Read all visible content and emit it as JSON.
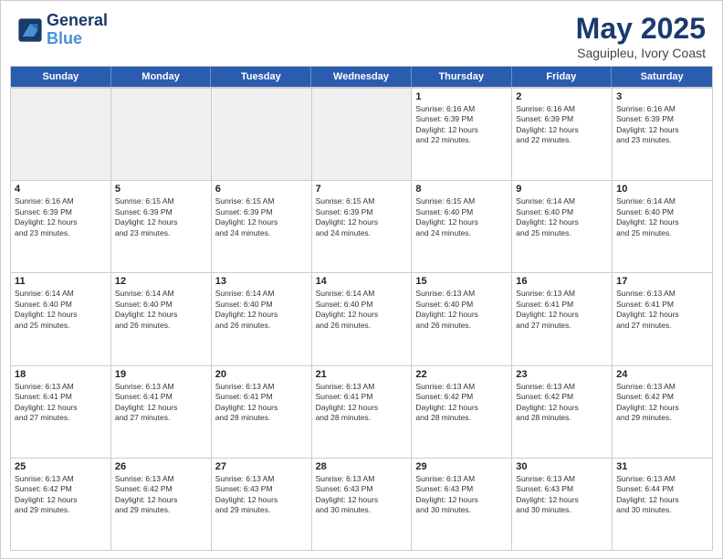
{
  "header": {
    "logo_line1": "General",
    "logo_line2": "Blue",
    "title": "May 2025",
    "subtitle": "Saguipleu, Ivory Coast"
  },
  "calendar": {
    "days_of_week": [
      "Sunday",
      "Monday",
      "Tuesday",
      "Wednesday",
      "Thursday",
      "Friday",
      "Saturday"
    ],
    "weeks": [
      [
        {
          "day": "",
          "info": "",
          "empty": true
        },
        {
          "day": "",
          "info": "",
          "empty": true
        },
        {
          "day": "",
          "info": "",
          "empty": true
        },
        {
          "day": "",
          "info": "",
          "empty": true
        },
        {
          "day": "1",
          "info": "Sunrise: 6:16 AM\nSunset: 6:39 PM\nDaylight: 12 hours\nand 22 minutes."
        },
        {
          "day": "2",
          "info": "Sunrise: 6:16 AM\nSunset: 6:39 PM\nDaylight: 12 hours\nand 22 minutes."
        },
        {
          "day": "3",
          "info": "Sunrise: 6:16 AM\nSunset: 6:39 PM\nDaylight: 12 hours\nand 23 minutes."
        }
      ],
      [
        {
          "day": "4",
          "info": "Sunrise: 6:16 AM\nSunset: 6:39 PM\nDaylight: 12 hours\nand 23 minutes."
        },
        {
          "day": "5",
          "info": "Sunrise: 6:15 AM\nSunset: 6:39 PM\nDaylight: 12 hours\nand 23 minutes."
        },
        {
          "day": "6",
          "info": "Sunrise: 6:15 AM\nSunset: 6:39 PM\nDaylight: 12 hours\nand 24 minutes."
        },
        {
          "day": "7",
          "info": "Sunrise: 6:15 AM\nSunset: 6:39 PM\nDaylight: 12 hours\nand 24 minutes."
        },
        {
          "day": "8",
          "info": "Sunrise: 6:15 AM\nSunset: 6:40 PM\nDaylight: 12 hours\nand 24 minutes."
        },
        {
          "day": "9",
          "info": "Sunrise: 6:14 AM\nSunset: 6:40 PM\nDaylight: 12 hours\nand 25 minutes."
        },
        {
          "day": "10",
          "info": "Sunrise: 6:14 AM\nSunset: 6:40 PM\nDaylight: 12 hours\nand 25 minutes."
        }
      ],
      [
        {
          "day": "11",
          "info": "Sunrise: 6:14 AM\nSunset: 6:40 PM\nDaylight: 12 hours\nand 25 minutes."
        },
        {
          "day": "12",
          "info": "Sunrise: 6:14 AM\nSunset: 6:40 PM\nDaylight: 12 hours\nand 26 minutes."
        },
        {
          "day": "13",
          "info": "Sunrise: 6:14 AM\nSunset: 6:40 PM\nDaylight: 12 hours\nand 26 minutes."
        },
        {
          "day": "14",
          "info": "Sunrise: 6:14 AM\nSunset: 6:40 PM\nDaylight: 12 hours\nand 26 minutes."
        },
        {
          "day": "15",
          "info": "Sunrise: 6:13 AM\nSunset: 6:40 PM\nDaylight: 12 hours\nand 26 minutes."
        },
        {
          "day": "16",
          "info": "Sunrise: 6:13 AM\nSunset: 6:41 PM\nDaylight: 12 hours\nand 27 minutes."
        },
        {
          "day": "17",
          "info": "Sunrise: 6:13 AM\nSunset: 6:41 PM\nDaylight: 12 hours\nand 27 minutes."
        }
      ],
      [
        {
          "day": "18",
          "info": "Sunrise: 6:13 AM\nSunset: 6:41 PM\nDaylight: 12 hours\nand 27 minutes."
        },
        {
          "day": "19",
          "info": "Sunrise: 6:13 AM\nSunset: 6:41 PM\nDaylight: 12 hours\nand 27 minutes."
        },
        {
          "day": "20",
          "info": "Sunrise: 6:13 AM\nSunset: 6:41 PM\nDaylight: 12 hours\nand 28 minutes."
        },
        {
          "day": "21",
          "info": "Sunrise: 6:13 AM\nSunset: 6:41 PM\nDaylight: 12 hours\nand 28 minutes."
        },
        {
          "day": "22",
          "info": "Sunrise: 6:13 AM\nSunset: 6:42 PM\nDaylight: 12 hours\nand 28 minutes."
        },
        {
          "day": "23",
          "info": "Sunrise: 6:13 AM\nSunset: 6:42 PM\nDaylight: 12 hours\nand 28 minutes."
        },
        {
          "day": "24",
          "info": "Sunrise: 6:13 AM\nSunset: 6:42 PM\nDaylight: 12 hours\nand 29 minutes."
        }
      ],
      [
        {
          "day": "25",
          "info": "Sunrise: 6:13 AM\nSunset: 6:42 PM\nDaylight: 12 hours\nand 29 minutes."
        },
        {
          "day": "26",
          "info": "Sunrise: 6:13 AM\nSunset: 6:42 PM\nDaylight: 12 hours\nand 29 minutes."
        },
        {
          "day": "27",
          "info": "Sunrise: 6:13 AM\nSunset: 6:43 PM\nDaylight: 12 hours\nand 29 minutes."
        },
        {
          "day": "28",
          "info": "Sunrise: 6:13 AM\nSunset: 6:43 PM\nDaylight: 12 hours\nand 30 minutes."
        },
        {
          "day": "29",
          "info": "Sunrise: 6:13 AM\nSunset: 6:43 PM\nDaylight: 12 hours\nand 30 minutes."
        },
        {
          "day": "30",
          "info": "Sunrise: 6:13 AM\nSunset: 6:43 PM\nDaylight: 12 hours\nand 30 minutes."
        },
        {
          "day": "31",
          "info": "Sunrise: 6:13 AM\nSunset: 6:44 PM\nDaylight: 12 hours\nand 30 minutes."
        }
      ]
    ]
  }
}
